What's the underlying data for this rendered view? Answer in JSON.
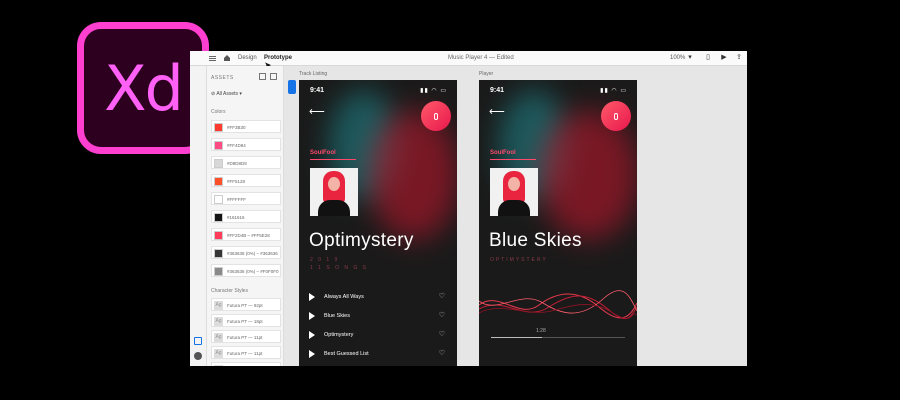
{
  "logo": {
    "text": "Xd"
  },
  "window": {
    "tabs": [
      "Design",
      "Prototype"
    ],
    "active_tab": "Prototype",
    "document_title": "Music Player 4  —  Edited",
    "zoom": "100%"
  },
  "assets_panel": {
    "title": "ASSETS",
    "filter": "All Assets",
    "colors_header": "Colors",
    "colors": [
      {
        "label": "#FF3B30",
        "hex": "#ff3b30"
      },
      {
        "label": "#FF4D84",
        "hex": "#ff4d84"
      },
      {
        "label": "#D8D8D8",
        "hex": "#d8d8d8"
      },
      {
        "label": "#FF5128",
        "hex": "#ff5128"
      },
      {
        "label": "#FFFFFF",
        "hex": "#ffffff"
      },
      {
        "label": "#161616",
        "hex": "#161616"
      },
      {
        "label": "#FF2D4B – #FF5E28",
        "hex": "#ff3d5b"
      },
      {
        "label": "#363636 (0%) – #363636",
        "hex": "#363636"
      },
      {
        "label": "#363636 (0%) – #F0F0F0",
        "hex": "#8a8a8a"
      }
    ],
    "character_styles_header": "Character Styles",
    "character_styles": [
      "Futura PT — 92pt",
      "Futura PT — 18pt",
      "Futura PT — 11pt",
      "Futura PT — 11pt",
      "SF Pro Text — 11pt"
    ]
  },
  "artboards": {
    "track_listing": {
      "title": "Track Listing",
      "time": "9:41",
      "artist": "SoulFool",
      "album": "Optimystery",
      "year": "2 0 1 9",
      "songs_count": "1 1  S O N G S",
      "tracks": [
        "Always All Ways",
        "Blue Skies",
        "Optimystery",
        "Best Guessed List"
      ]
    },
    "player": {
      "title": "Player",
      "time": "9:41",
      "artist": "SoulFool",
      "song": "Blue Skies",
      "album": "OPTIMYSTERY",
      "elapsed": "1:28",
      "progress": 0.38
    }
  },
  "colors": {
    "accent": "#ff4a6d",
    "mic": "#e8174c",
    "selection_blue": "#1473e6"
  }
}
